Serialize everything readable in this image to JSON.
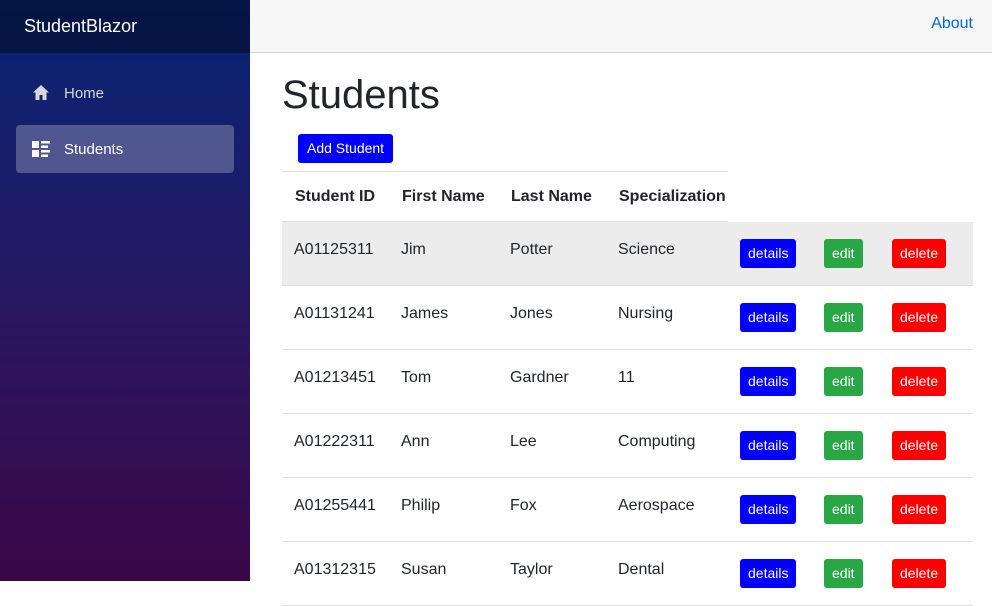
{
  "app": {
    "brand": "StudentBlazor"
  },
  "sidebar": {
    "items": [
      {
        "label": "Home",
        "icon": "home-icon"
      },
      {
        "label": "Students",
        "icon": "list-icon"
      }
    ]
  },
  "topbar": {
    "about_label": "About"
  },
  "page": {
    "title": "Students",
    "add_button": "Add Student"
  },
  "table": {
    "headers": [
      "Student ID",
      "First Name",
      "Last Name",
      "Specialization"
    ],
    "rows": [
      {
        "id": "A01125311",
        "first": "Jim",
        "last": "Potter",
        "spec": "Science"
      },
      {
        "id": "A01131241",
        "first": "James",
        "last": "Jones",
        "spec": "Nursing"
      },
      {
        "id": "A01213451",
        "first": "Tom",
        "last": "Gardner",
        "spec": "11"
      },
      {
        "id": "A01222311",
        "first": "Ann",
        "last": "Lee",
        "spec": "Computing"
      },
      {
        "id": "A01255441",
        "first": "Philip",
        "last": "Fox",
        "spec": "Aerospace"
      },
      {
        "id": "A01312315",
        "first": "Susan",
        "last": "Taylor",
        "spec": "Dental"
      }
    ],
    "actions": {
      "details": "details",
      "edit": "edit",
      "delete": "delete"
    }
  },
  "colors": {
    "primary_button": "#0000ff",
    "edit_button": "#28a745",
    "delete_button": "#ff0000",
    "link": "#0366d6"
  }
}
